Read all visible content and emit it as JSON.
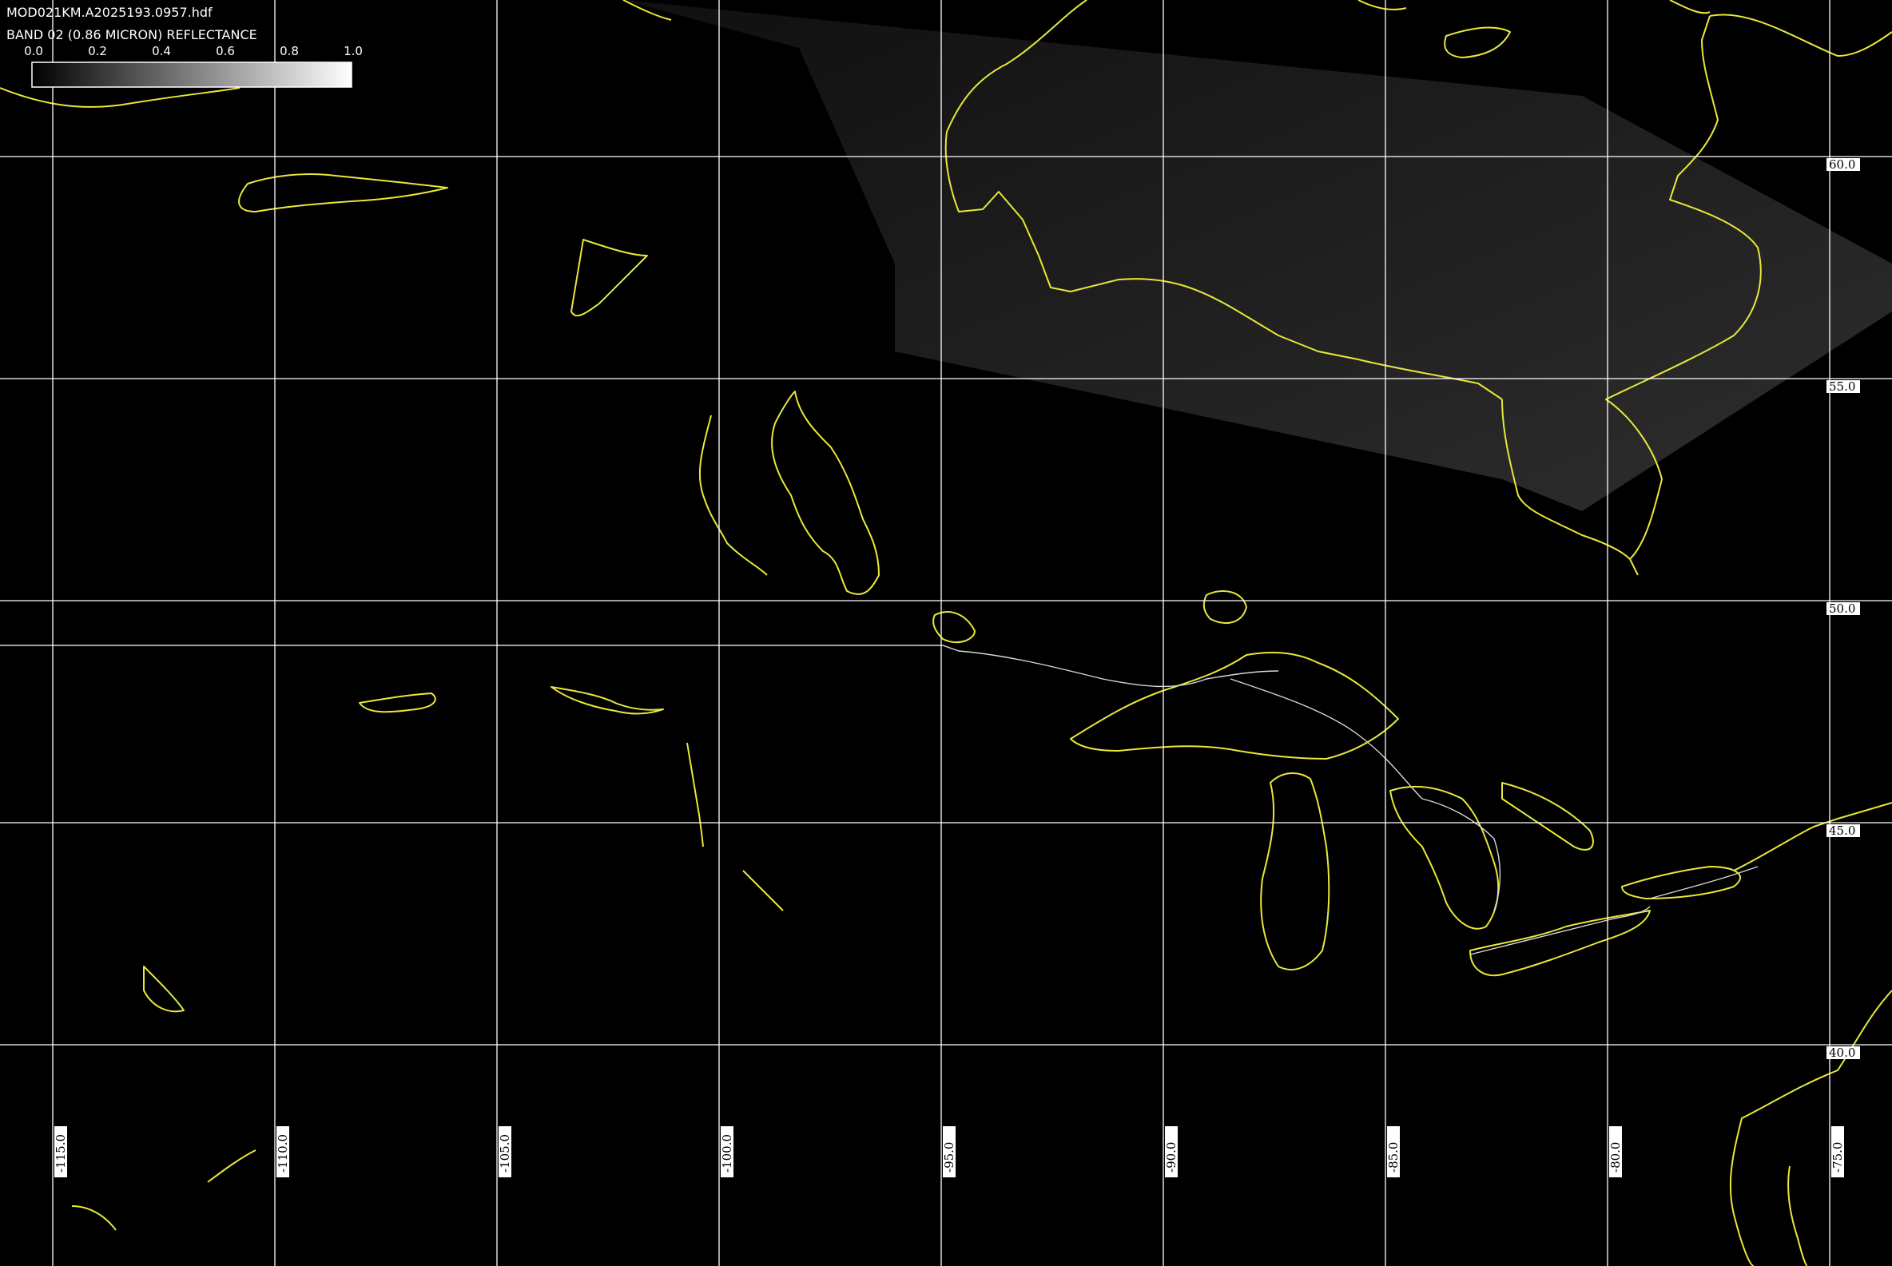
{
  "header": {
    "filename": "MOD021KM.A2025193.0957.hdf",
    "band_title": "BAND 02 (0.86 MICRON) REFLECTANCE"
  },
  "colorbar": {
    "ticks": [
      "0.0",
      "0.2",
      "0.4",
      "0.6",
      "0.8",
      "1.0"
    ],
    "range": [
      0.0,
      1.0
    ],
    "start_color": "#000000",
    "end_color": "#ffffff"
  },
  "grid": {
    "line_color": "#ffffff",
    "latitudes": [
      {
        "value": 60.0,
        "label": "60.0"
      },
      {
        "value": 55.0,
        "label": "55.0"
      },
      {
        "value": 50.0,
        "label": "50.0"
      },
      {
        "value": 45.0,
        "label": "45.0"
      },
      {
        "value": 40.0,
        "label": "40.0"
      }
    ],
    "longitudes": [
      {
        "value": -115.0,
        "label": "-115.0"
      },
      {
        "value": -110.0,
        "label": "-110.0"
      },
      {
        "value": -105.0,
        "label": "-105.0"
      },
      {
        "value": -100.0,
        "label": "-100.0"
      },
      {
        "value": -95.0,
        "label": "-95.0"
      },
      {
        "value": -90.0,
        "label": "-90.0"
      },
      {
        "value": -85.0,
        "label": "-85.0"
      },
      {
        "value": -80.0,
        "label": "-80.0"
      },
      {
        "value": -75.0,
        "label": "-75.0"
      }
    ]
  },
  "styles": {
    "coastline_color": "#e8e83a",
    "border_color": "#d8d8d8",
    "background_color": "#000000"
  }
}
